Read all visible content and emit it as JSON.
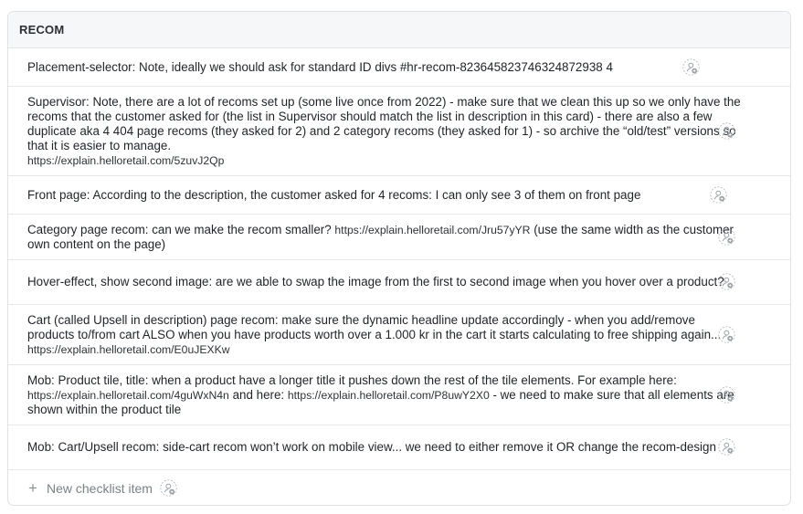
{
  "card": {
    "title": "RECOM"
  },
  "items": [
    {
      "pre": "Placement-selector: Note, ideally we should ask for standard ID divs #hr-recom-823645823746324872938 4",
      "link": "",
      "post": ""
    },
    {
      "pre": "Supervisor: Note, there are a lot of recoms set up (some live once from 2022) - make sure that we clean this up so we only have the recoms that the customer asked for (the list in Supervisor should match the list in description in this card) - there are also a few duplicate aka 4 404 page recoms (they asked for 2) and 2 category recoms (they asked for 1) - so archive the “old/test” versions so that it is easier to manage.",
      "link": "https://explain.helloretail.com/5zuvJ2Qp",
      "post": ""
    },
    {
      "pre": "Front page: According to the description, the customer asked for 4 recoms: I can only see 3 of them on front page",
      "link": "",
      "post": ""
    },
    {
      "pre": "Category page recom: can we make the recom smaller? ",
      "link": "https://explain.helloretail.com/Jru57yYR",
      "post": "  (use the same width as the customer own content on the page)"
    },
    {
      "pre": "Hover-effect, show second image: are we able to swap the image from the first to second image when you hover over a product?",
      "link": "",
      "post": ""
    },
    {
      "pre": "Cart (called Upsell in description) page recom: make sure the dynamic headline update accordingly - when you add/remove products to/from cart ALSO when you have products worth over a 1.000 kr in the cart it starts calculating to free shipping again... ",
      "link": "https://explain.helloretail.com/E0uJEXKw",
      "post": ""
    },
    {
      "pre": "Mob: Product tile, title: when a product have a longer title it pushes down the rest of the tile elements. For example here: ",
      "link": "https://explain.helloretail.com/4guWxN4n",
      "post": "  and here: ",
      "link2": "https://explain.helloretail.com/P8uwY2X0",
      "post2": "  - we need to make sure that all elements are shown within the product tile"
    },
    {
      "pre": "Mob: Cart/Upsell recom: side-cart recom won’t work on mobile view... we need to either remove it OR change the recom-design",
      "link": "",
      "post": ""
    }
  ],
  "add_item": {
    "icon": "plus-icon",
    "label": "New checklist item"
  },
  "icons": {
    "assign": "assign-member-icon"
  }
}
